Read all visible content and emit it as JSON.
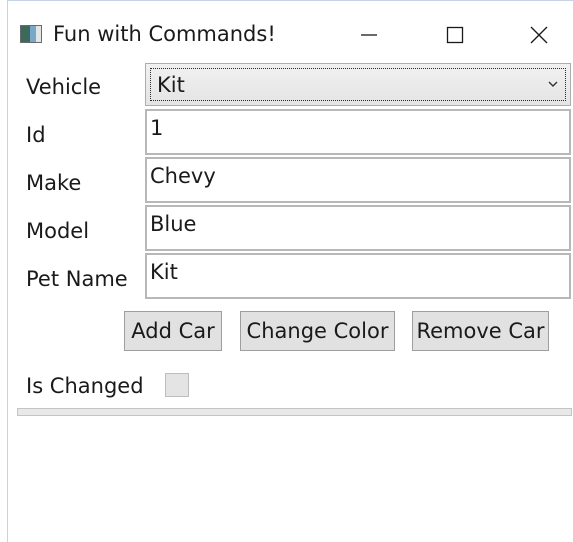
{
  "window": {
    "title": "Fun with Commands!",
    "icons": {
      "app": "app-window-icon",
      "minimize": "minimize-icon",
      "maximize": "maximize-icon",
      "close": "close-icon"
    }
  },
  "form": {
    "vehicle": {
      "label": "Vehicle",
      "selected": "Kit",
      "arrow_icon": "chevron-down-icon"
    },
    "id": {
      "label": "Id",
      "value": "1"
    },
    "make": {
      "label": "Make",
      "value": "Chevy"
    },
    "model": {
      "label": "Model",
      "value": "Blue"
    },
    "pet_name": {
      "label": "Pet Name",
      "value": "Kit"
    }
  },
  "buttons": {
    "add_car": "Add Car",
    "change_color": "Change Color",
    "remove_car": "Remove Car"
  },
  "is_changed": {
    "label": "Is Changed",
    "checked": false
  },
  "colors": {
    "window_border": "#c8d4e6",
    "button_face": "#e1e1e1",
    "field_border": "#b8b8b8"
  }
}
